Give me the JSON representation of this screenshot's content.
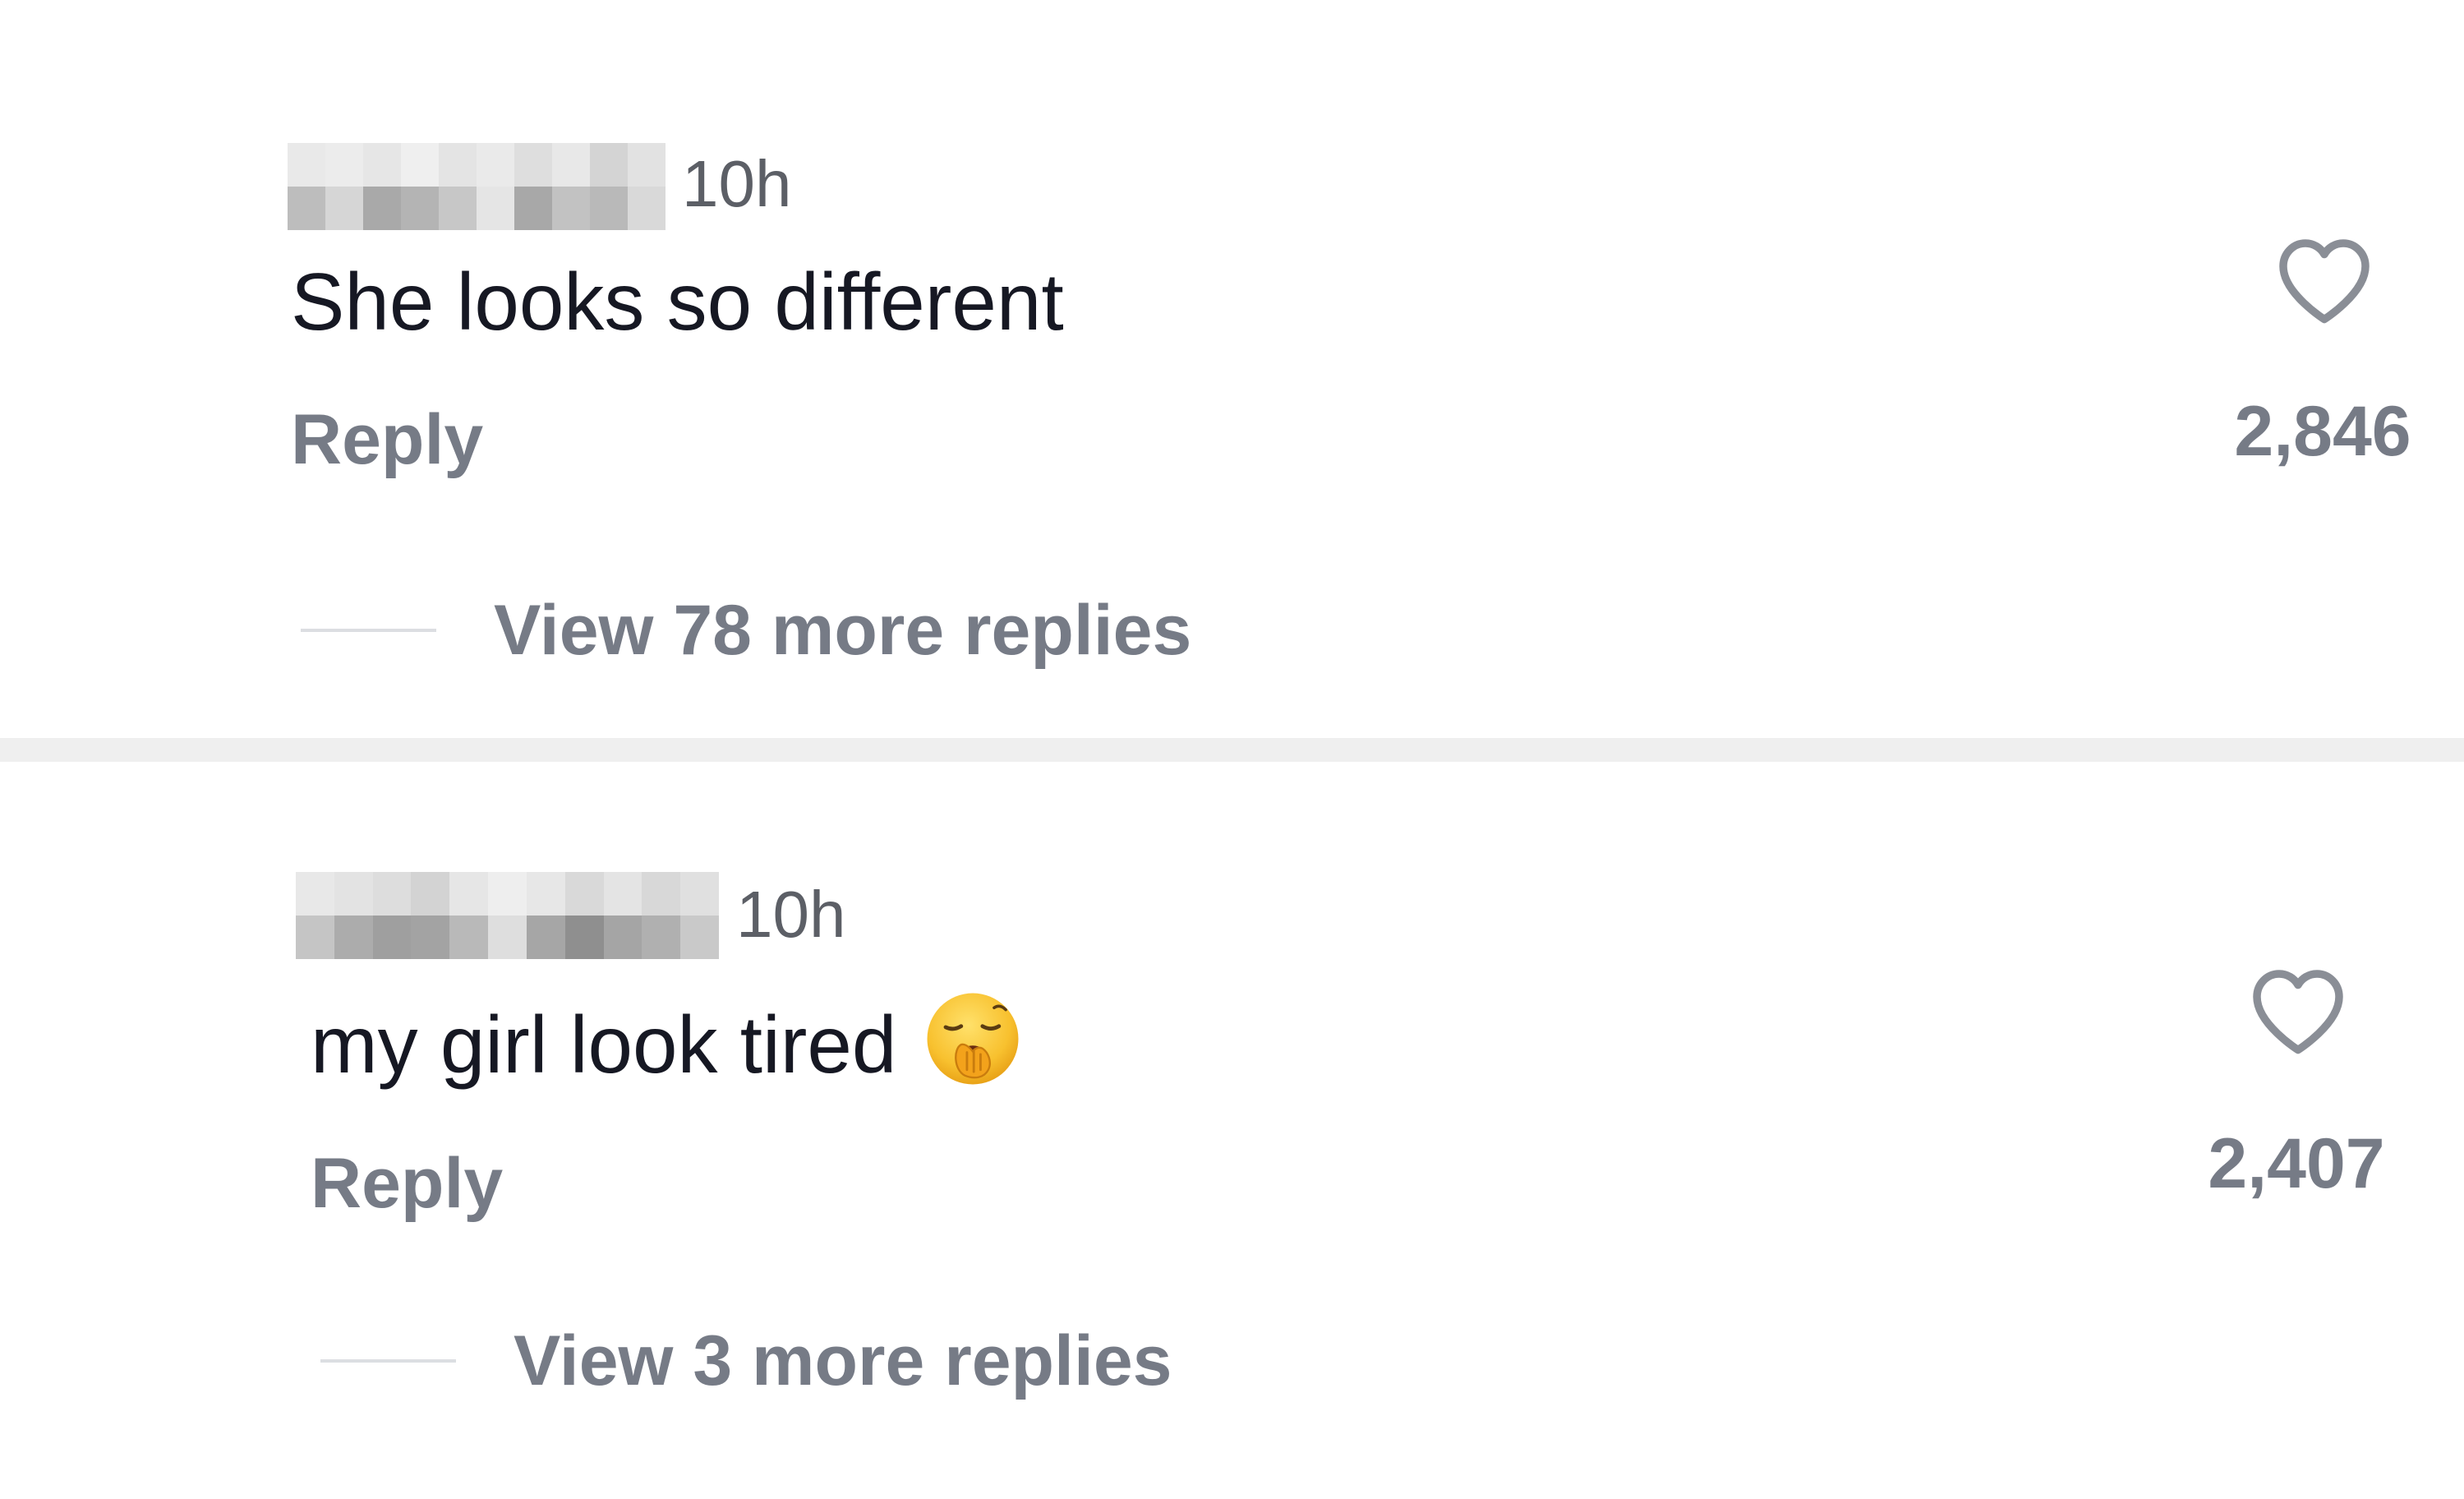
{
  "comments": [
    {
      "username_redacted": true,
      "timestamp": "10h",
      "text": "She looks so different",
      "reply_label": "Reply",
      "like_count": "2,846",
      "view_replies_label": "View 78 more replies",
      "liked": false
    },
    {
      "username_redacted": true,
      "timestamp": "10h",
      "text": "my girl look tired",
      "emoji": "yawning-face",
      "reply_label": "Reply",
      "like_count": "2,407",
      "view_replies_label": "View 3 more replies",
      "liked": false
    }
  ],
  "icons": {
    "like": "heart-outline-icon"
  },
  "colors": {
    "text_primary": "#161823",
    "text_secondary": "#767b86",
    "timestamp": "#5c5f66",
    "divider": "#efefef",
    "reply_line": "#dcdee2",
    "heart_stroke": "#8a8e96"
  }
}
